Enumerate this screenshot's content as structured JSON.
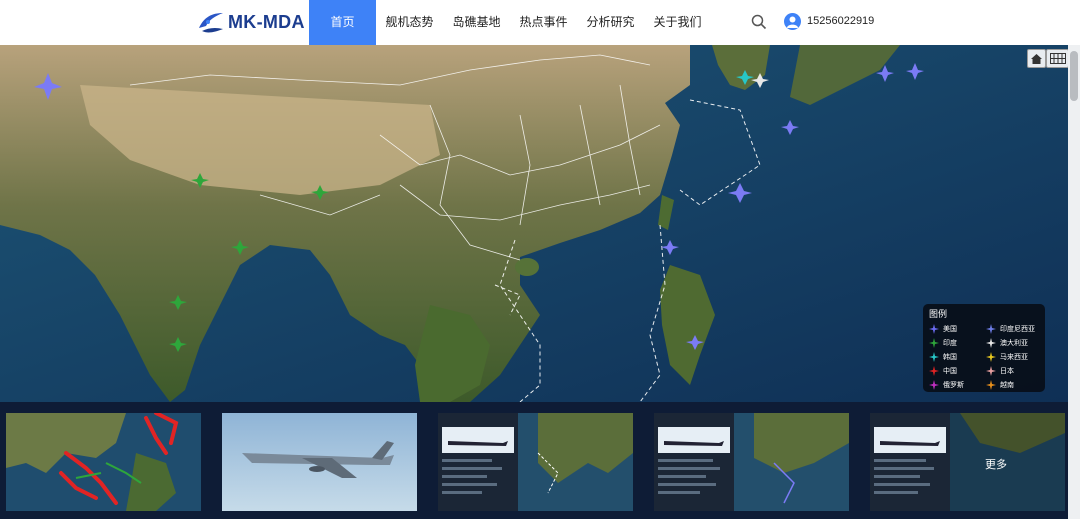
{
  "header": {
    "logo_text": "MK-MDA",
    "nav": [
      {
        "label": "首页",
        "active": true
      },
      {
        "label": "舰机态势"
      },
      {
        "label": "岛礁基地"
      },
      {
        "label": "热点事件"
      },
      {
        "label": "分析研究"
      },
      {
        "label": "关于我们"
      }
    ],
    "user": {
      "phone": "15256022919"
    }
  },
  "map": {
    "legend_title": "图例",
    "legend": [
      {
        "label": "美国",
        "color": "#6b6bf2"
      },
      {
        "label": "印度尼西亚",
        "color": "#1b2a8a"
      },
      {
        "label": "印度",
        "color": "#2ea63b"
      },
      {
        "label": "澳大利亚",
        "color": "#e8e8e8"
      },
      {
        "label": "韩国",
        "color": "#27c7c7"
      },
      {
        "label": "马来西亚",
        "color": "#e8c81f"
      },
      {
        "label": "中国",
        "color": "#e12424"
      },
      {
        "label": "日本",
        "color": "#e8a0a0"
      },
      {
        "label": "俄罗斯",
        "color": "#c02fc0"
      },
      {
        "label": "越南",
        "color": "#e8901c"
      }
    ]
  },
  "thumbnails": {
    "more_label": "更多"
  }
}
